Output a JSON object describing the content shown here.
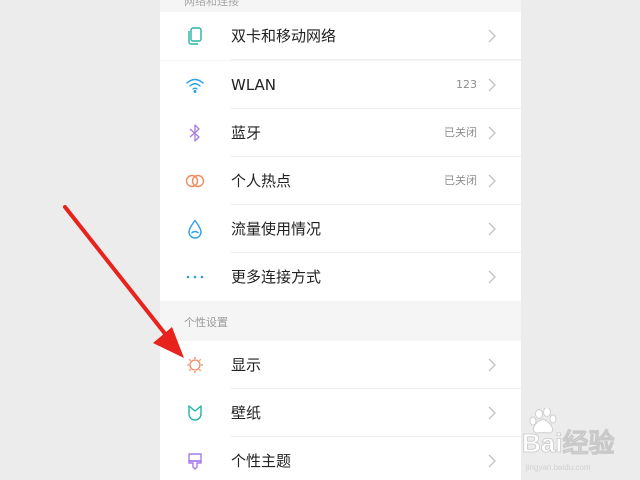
{
  "top_section_header": "网络和连接",
  "personal_section_header": "个性设置",
  "rows": [
    {
      "label": "双卡和移动网络",
      "value": "",
      "icon": "sim-card-icon",
      "color": "#23b5a6"
    },
    {
      "label": "WLAN",
      "value": "123",
      "icon": "wifi-icon",
      "color": "#2aa0e8"
    },
    {
      "label": "蓝牙",
      "value": "已关闭",
      "icon": "bluetooth-icon",
      "color": "#a57be6"
    },
    {
      "label": "个人热点",
      "value": "已关闭",
      "icon": "hotspot-icon",
      "color": "#f28a5c"
    },
    {
      "label": "流量使用情况",
      "value": "",
      "icon": "data-usage-icon",
      "color": "#2aa0e8"
    },
    {
      "label": "更多连接方式",
      "value": "",
      "icon": "more-dots-icon",
      "color": "#2aa0e8"
    },
    {
      "label": "显示",
      "value": "",
      "icon": "display-sun-icon",
      "color": "#f28a5c"
    },
    {
      "label": "壁纸",
      "value": "",
      "icon": "wallpaper-icon",
      "color": "#23b5a6"
    },
    {
      "label": "个性主题",
      "value": "",
      "icon": "theme-icon",
      "color": "#a57be6"
    }
  ],
  "watermark": {
    "text": "Bai经验",
    "subtext": "jingyan.baidu.com"
  },
  "annotation_arrow_color": "#e8221c"
}
